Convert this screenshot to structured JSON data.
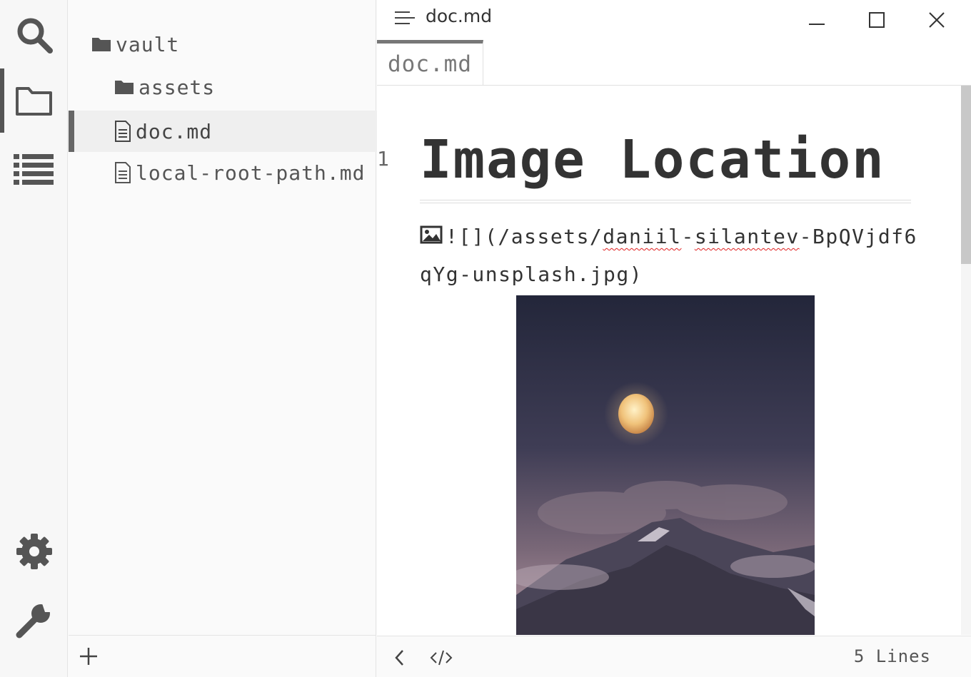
{
  "activity_bar": {
    "items": [
      {
        "name": "search-icon"
      },
      {
        "name": "folder-icon",
        "active": true
      },
      {
        "name": "list-icon"
      },
      {
        "name": "gear-icon"
      },
      {
        "name": "wrench-icon"
      }
    ]
  },
  "sidebar": {
    "tree": [
      {
        "label": "vault",
        "type": "folder",
        "icon": "folder-icon"
      },
      {
        "label": "assets",
        "type": "folder",
        "icon": "folder-icon"
      },
      {
        "label": "doc.md",
        "type": "file",
        "icon": "file-icon",
        "selected": true
      },
      {
        "label": "local-root-path.md",
        "type": "file",
        "icon": "file-icon"
      }
    ],
    "footer": {
      "add_icon": "plus-icon"
    }
  },
  "window": {
    "title": "doc.md",
    "menu_icon": "menu-icon",
    "controls": [
      "minimize-icon",
      "maximize-icon",
      "close-icon"
    ]
  },
  "tabs": [
    {
      "label": "doc.md",
      "active": true
    }
  ],
  "document": {
    "line_number": "1",
    "heading": "Image Location",
    "image_markdown_prefix": "![](/assets/",
    "image_markdown_typo1": "daniil",
    "image_markdown_sep": "-",
    "image_markdown_typo2": "silantev",
    "image_markdown_suffix": "-BpQVjdf6qYg-unsplash.jpg)"
  },
  "statusbar": {
    "back_icon": "chevron-left-icon",
    "source_icon": "code-icon",
    "lines": "5 Lines"
  },
  "colors": {
    "icon": "#555555",
    "accent": "#666666",
    "spell_error": "#e02020"
  }
}
